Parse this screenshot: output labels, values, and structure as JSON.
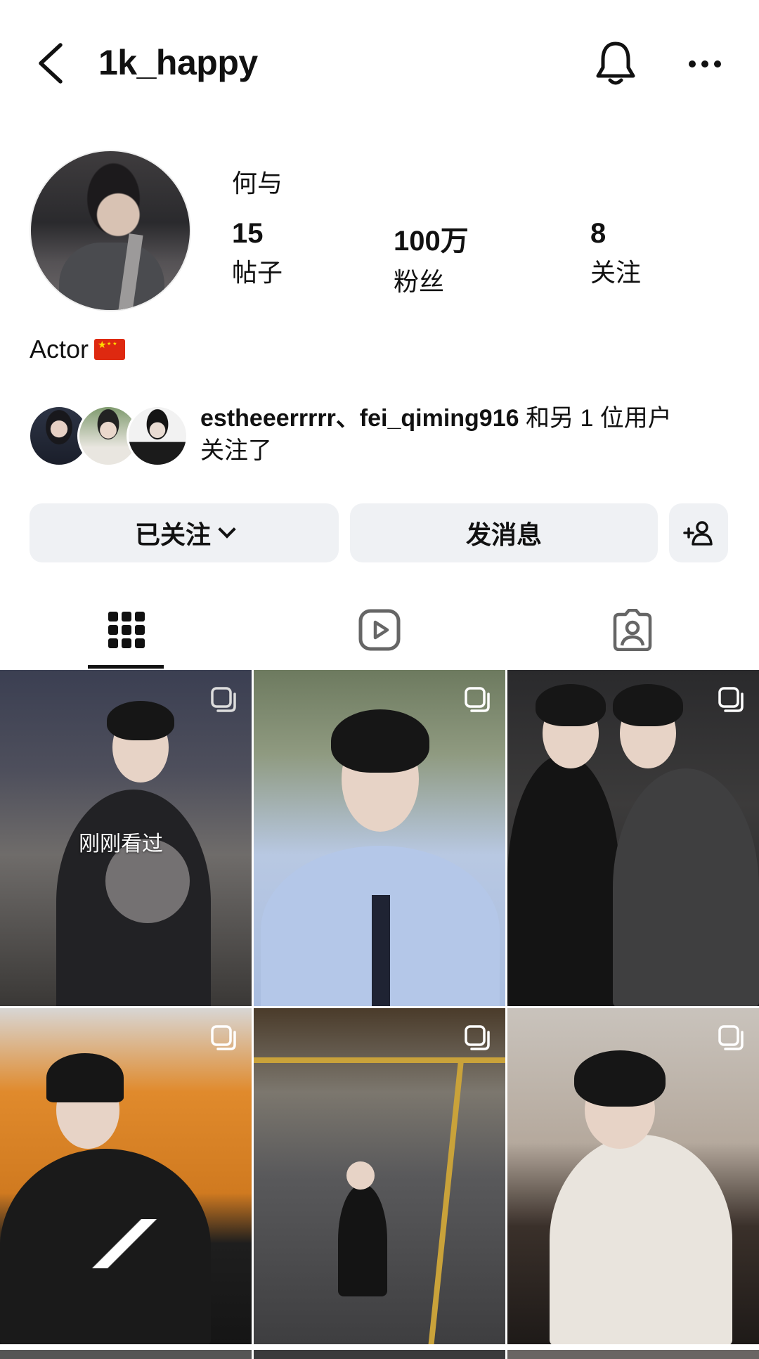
{
  "header": {
    "username": "1k_happy",
    "icons": [
      "back-icon",
      "bell-icon",
      "more-icon"
    ]
  },
  "profile": {
    "display_name": "何与",
    "stats": [
      {
        "value": "15",
        "label": "帖子"
      },
      {
        "value": "100万",
        "label": "粉丝"
      },
      {
        "value": "8",
        "label": "关注"
      }
    ],
    "bio": "Actor"
  },
  "mutuals": {
    "names": "estheeerrrrr、fei_qiming916",
    "suffix": " 和另 1 位用户",
    "line2": "关注了"
  },
  "actions": {
    "following_label": "已关注",
    "message_label": "发消息"
  },
  "tabs": [
    "grid-icon",
    "reels-icon",
    "tagged-icon"
  ],
  "posts": {
    "watched_label": "刚刚看过"
  },
  "colors": {
    "button_bg": "#eff1f4",
    "text": "#111111",
    "background": "#ffffff"
  }
}
